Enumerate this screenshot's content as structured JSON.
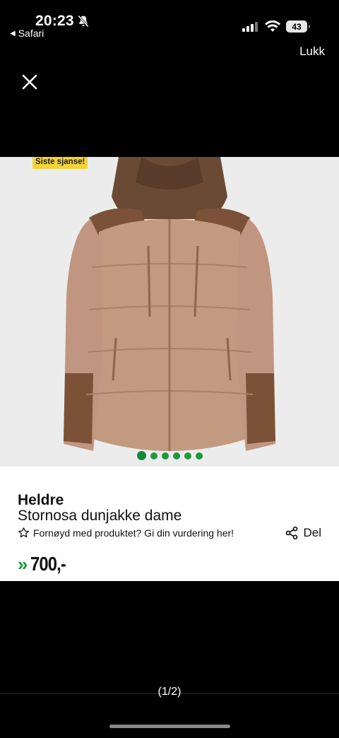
{
  "status_bar": {
    "time": "20:23",
    "back_app": "Safari",
    "battery": "43"
  },
  "header": {
    "close_label": "Lukk"
  },
  "gallery": {
    "badge": "Siste sjanse!",
    "image_count": 6,
    "active_index": 0
  },
  "product": {
    "brand": "Heldre",
    "name": "Stornosa dunjakke dame",
    "rating_prompt": "Fornøyd med produktet? Gi din vurdering her!",
    "share_label": "Del",
    "price_chevron": "»",
    "price": "700,-"
  },
  "footer": {
    "page_indicator": "(1/2)"
  },
  "colors": {
    "accent_green": "#1a9a3a",
    "badge_yellow": "#f5d33a",
    "background": "#000000"
  },
  "icons": [
    "bell-slash-icon",
    "signal-icon",
    "wifi-icon",
    "battery-icon",
    "close-icon",
    "star-outline-icon",
    "share-icon"
  ]
}
